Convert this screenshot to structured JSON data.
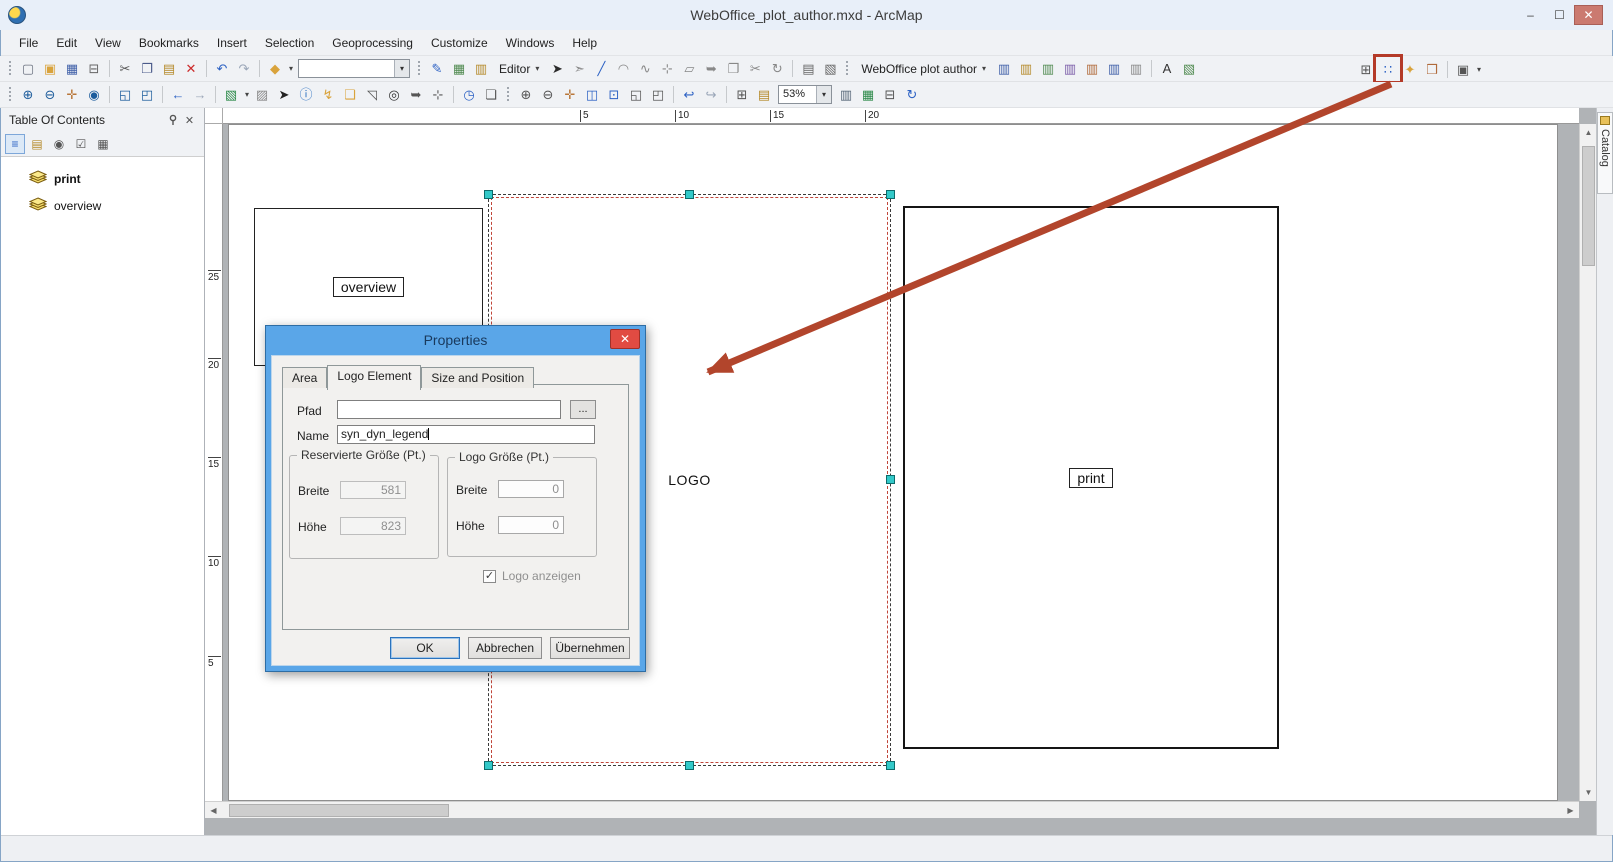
{
  "window": {
    "title": "WebOffice_plot_author.mxd - ArcMap",
    "controls": {
      "minimize": "–",
      "maximize": "☐",
      "close": "✕"
    }
  },
  "menu": [
    "File",
    "Edit",
    "View",
    "Bookmarks",
    "Insert",
    "Selection",
    "Geoprocessing",
    "Customize",
    "Windows",
    "Help"
  ],
  "toolbar1": {
    "items": [
      {
        "type": "grip",
        "name": "toolbar-grip"
      },
      {
        "type": "icon",
        "name": "new-document-icon",
        "glyph": "▢",
        "color": "#6b7280"
      },
      {
        "type": "icon",
        "name": "open-icon",
        "glyph": "▣",
        "color": "#d9a33c"
      },
      {
        "type": "icon",
        "name": "save-icon",
        "glyph": "▦",
        "color": "#3f5fa8"
      },
      {
        "type": "icon",
        "name": "print-icon",
        "glyph": "⊟",
        "color": "#666666"
      },
      {
        "type": "sep"
      },
      {
        "type": "icon",
        "name": "cut-icon",
        "glyph": "✂",
        "color": "#555555"
      },
      {
        "type": "icon",
        "name": "copy-icon",
        "glyph": "❐",
        "color": "#4a5a8a"
      },
      {
        "type": "icon",
        "name": "paste-icon",
        "glyph": "▤",
        "color": "#b58a2a"
      },
      {
        "type": "icon",
        "name": "delete-icon",
        "glyph": "✕",
        "color": "#cc2b2b"
      },
      {
        "type": "sep"
      },
      {
        "type": "icon",
        "name": "undo-icon",
        "glyph": "↶",
        "color": "#2d62c4"
      },
      {
        "type": "icon",
        "name": "redo-icon",
        "glyph": "↷",
        "color": "#9aa6b8"
      },
      {
        "type": "sep"
      },
      {
        "type": "icon",
        "name": "add-data-icon",
        "glyph": "◆",
        "color": "#d9a33c",
        "dropdown": true
      },
      {
        "type": "combo",
        "name": "map-scale-combo",
        "value": "",
        "width": 112
      },
      {
        "type": "grip",
        "name": "toolbar-grip"
      },
      {
        "type": "icon",
        "name": "editor-sketch-icon",
        "glyph": "✎",
        "color": "#2d62c4"
      },
      {
        "type": "icon",
        "name": "snapping-icon",
        "glyph": "▦",
        "color": "#4f8a4f"
      },
      {
        "type": "icon",
        "name": "create-features-icon",
        "glyph": "▥",
        "color": "#b58a2a"
      },
      {
        "type": "menu-button",
        "name": "editor-menu",
        "label": "Editor"
      },
      {
        "type": "icon",
        "name": "edit-tool-icon",
        "glyph": "➤",
        "color": "#2b2b2b"
      },
      {
        "type": "icon",
        "name": "edit-annotation-icon",
        "glyph": "➣",
        "color": "#888888"
      },
      {
        "type": "icon",
        "name": "straight-segment-icon",
        "glyph": "╱",
        "color": "#2d62c4"
      },
      {
        "type": "icon",
        "name": "arc-segment-icon",
        "glyph": "◠",
        "color": "#888888"
      },
      {
        "type": "icon",
        "name": "trace-icon",
        "glyph": "∿",
        "color": "#888888"
      },
      {
        "type": "icon",
        "name": "point-tool-icon",
        "glyph": "⊹",
        "color": "#888888"
      },
      {
        "type": "icon",
        "name": "edit-vertices-icon",
        "glyph": "▱",
        "color": "#888888"
      },
      {
        "type": "icon",
        "name": "reshape-icon",
        "glyph": "➥",
        "color": "#888888"
      },
      {
        "type": "icon",
        "name": "cut-polygons-icon",
        "glyph": "❐",
        "color": "#888888"
      },
      {
        "type": "icon",
        "name": "split-icon",
        "glyph": "✂",
        "color": "#888888"
      },
      {
        "type": "icon",
        "name": "rotate-icon",
        "glyph": "↻",
        "color": "#888888"
      },
      {
        "type": "sep"
      },
      {
        "type": "icon",
        "name": "attributes-icon",
        "glyph": "▤",
        "color": "#666666"
      },
      {
        "type": "icon",
        "name": "sketch-properties-icon",
        "glyph": "▧",
        "color": "#666666"
      },
      {
        "type": "grip",
        "name": "toolbar-grip"
      },
      {
        "type": "menu-button",
        "name": "weboffice-plot-author-menu",
        "label": "WebOffice plot author"
      },
      {
        "type": "icon",
        "name": "wo-load-icon",
        "glyph": "▥",
        "color": "#3f5fa8"
      },
      {
        "type": "icon",
        "name": "wo-save-icon",
        "glyph": "▥",
        "color": "#b58a2a"
      },
      {
        "type": "icon",
        "name": "wo-new-icon",
        "glyph": "▥",
        "color": "#4f8a4f"
      },
      {
        "type": "icon",
        "name": "wo-import-icon",
        "glyph": "▥",
        "color": "#7a5ca8"
      },
      {
        "type": "icon",
        "name": "wo-export-icon",
        "glyph": "▥",
        "color": "#b06a3a"
      },
      {
        "type": "icon",
        "name": "wo-pages-icon",
        "glyph": "▥",
        "color": "#3f5fa8"
      },
      {
        "type": "icon",
        "name": "wo-frame-icon",
        "glyph": "▥",
        "color": "#888888"
      },
      {
        "type": "sep"
      },
      {
        "type": "icon",
        "name": "text-element-icon",
        "glyph": "A",
        "color": "#333333"
      },
      {
        "type": "icon",
        "name": "label-manager-icon",
        "glyph": "▧",
        "color": "#4f8a4f"
      }
    ],
    "end_items": [
      {
        "type": "icon",
        "name": "grid-icon",
        "glyph": "⊞",
        "color": "#555555"
      },
      {
        "type": "icon",
        "name": "synoptic-legend-icon",
        "glyph": "∷",
        "color": "#2d62c4",
        "highlight": true
      },
      {
        "type": "icon",
        "name": "star-icon",
        "glyph": "✦",
        "color": "#d9a33c"
      },
      {
        "type": "icon",
        "name": "export-icon",
        "glyph": "❒",
        "color": "#b06a3a"
      },
      {
        "type": "sep"
      },
      {
        "type": "icon",
        "name": "layers-menu-icon",
        "glyph": "▣",
        "color": "#555555",
        "dropdown": true
      }
    ]
  },
  "toolbar2": {
    "items": [
      {
        "type": "grip",
        "name": "toolbar-grip"
      },
      {
        "type": "icon",
        "name": "zoom-in-icon",
        "glyph": "⊕",
        "color": "#1c5c9c"
      },
      {
        "type": "icon",
        "name": "zoom-out-icon",
        "glyph": "⊖",
        "color": "#1c5c9c"
      },
      {
        "type": "icon",
        "name": "pan-icon",
        "glyph": "✛",
        "color": "#b9773a"
      },
      {
        "type": "icon",
        "name": "full-extent-icon",
        "glyph": "◉",
        "color": "#1c5c9c"
      },
      {
        "type": "sep"
      },
      {
        "type": "icon",
        "name": "fixed-zoom-in-icon",
        "glyph": "◱",
        "color": "#1c5c9c"
      },
      {
        "type": "icon",
        "name": "fixed-zoom-out-icon",
        "glyph": "◰",
        "color": "#1c5c9c"
      },
      {
        "type": "sep"
      },
      {
        "type": "icon",
        "name": "back-extent-icon",
        "glyph": "←",
        "color": "#2d62c4"
      },
      {
        "type": "icon",
        "name": "forward-extent-icon",
        "glyph": "→",
        "color": "#9aa6b8"
      },
      {
        "type": "sep"
      },
      {
        "type": "icon",
        "name": "select-features-icon",
        "glyph": "▧",
        "color": "#2d8a4a",
        "dropdown": true
      },
      {
        "type": "icon",
        "name": "clear-selection-icon",
        "glyph": "▨",
        "color": "#888888"
      },
      {
        "type": "icon",
        "name": "select-elements-icon",
        "glyph": "➤",
        "color": "#222222"
      },
      {
        "type": "icon",
        "name": "identify-icon",
        "glyph": "ⓘ",
        "color": "#2a6fc0"
      },
      {
        "type": "icon",
        "name": "hyperlink-icon",
        "glyph": "↯",
        "color": "#d9a33c"
      },
      {
        "type": "icon",
        "name": "html-popup-icon",
        "glyph": "❑",
        "color": "#d9a33c"
      },
      {
        "type": "icon",
        "name": "measure-icon",
        "glyph": "◹",
        "color": "#555555"
      },
      {
        "type": "icon",
        "name": "find-icon",
        "glyph": "◎",
        "color": "#333333"
      },
      {
        "type": "icon",
        "name": "find-route-icon",
        "glyph": "➥",
        "color": "#555555"
      },
      {
        "type": "icon",
        "name": "goto-xy-icon",
        "glyph": "⊹",
        "color": "#555555"
      },
      {
        "type": "sep"
      },
      {
        "type": "icon",
        "name": "time-slider-icon",
        "glyph": "◷",
        "color": "#2d62c4"
      },
      {
        "type": "icon",
        "name": "viewer-window-icon",
        "glyph": "❏",
        "color": "#555555"
      },
      {
        "type": "grip",
        "name": "toolbar-grip"
      },
      {
        "type": "icon",
        "name": "layout-zoom-in-icon",
        "glyph": "⊕",
        "color": "#555555"
      },
      {
        "type": "icon",
        "name": "layout-zoom-out-icon",
        "glyph": "⊖",
        "color": "#555555"
      },
      {
        "type": "icon",
        "name": "layout-pan-icon",
        "glyph": "✛",
        "color": "#b9773a"
      },
      {
        "type": "icon",
        "name": "zoom-whole-page-icon",
        "glyph": "◫",
        "color": "#2d62c4"
      },
      {
        "type": "icon",
        "name": "zoom-100-icon",
        "glyph": "⊡",
        "color": "#2d62c4"
      },
      {
        "type": "icon",
        "name": "layout-fixed-zoom-in-icon",
        "glyph": "◱",
        "color": "#555555"
      },
      {
        "type": "icon",
        "name": "layout-fixed-zoom-out-icon",
        "glyph": "◰",
        "color": "#555555"
      },
      {
        "type": "sep"
      },
      {
        "type": "icon",
        "name": "previous-extent-icon",
        "glyph": "↩",
        "color": "#2d62c4"
      },
      {
        "type": "icon",
        "name": "next-extent-icon",
        "glyph": "↪",
        "color": "#9aa6b8"
      },
      {
        "type": "sep"
      },
      {
        "type": "icon",
        "name": "focus-data-frame-icon",
        "glyph": "⊞",
        "color": "#555555"
      },
      {
        "type": "icon",
        "name": "change-layout-icon",
        "glyph": "▤",
        "color": "#b58a2a"
      },
      {
        "type": "combo",
        "name": "zoom-percent-combo",
        "value": "53%",
        "width": 54
      },
      {
        "type": "icon",
        "name": "draft-mode-icon",
        "glyph": "▥",
        "color": "#556677"
      },
      {
        "type": "icon",
        "name": "data-driven-pages-icon",
        "glyph": "▦",
        "color": "#2d8a4a"
      },
      {
        "type": "icon",
        "name": "page-text-icon",
        "glyph": "⊟",
        "color": "#555555"
      },
      {
        "type": "icon",
        "name": "refresh-icon",
        "glyph": "↻",
        "color": "#2d62c4"
      }
    ]
  },
  "toc": {
    "title": "Table Of Contents",
    "close_glyph": "✕",
    "tools": [
      {
        "name": "list-by-drawing-order-icon",
        "glyph": "≡",
        "color": "#2d62c4",
        "pressed": true
      },
      {
        "name": "list-by-source-icon",
        "glyph": "▤",
        "color": "#b58a2a",
        "pressed": false
      },
      {
        "name": "list-by-visibility-icon",
        "glyph": "◉",
        "color": "#555555",
        "pressed": false
      },
      {
        "name": "list-by-selection-icon",
        "glyph": "☑",
        "color": "#555555",
        "pressed": false
      },
      {
        "name": "options-icon",
        "glyph": "▦",
        "color": "#555555",
        "pressed": false
      }
    ],
    "items": [
      {
        "label": "print",
        "bold": true
      },
      {
        "label": "overview",
        "bold": false
      }
    ]
  },
  "rulers": {
    "top_labels": [
      "5",
      "10",
      "15",
      "20"
    ],
    "left_labels": [
      "25",
      "20",
      "15",
      "10",
      "5"
    ]
  },
  "layout": {
    "overview_label": "overview",
    "logo_label": "LOGO",
    "print_label": "print"
  },
  "catalog": {
    "label": "Catalog"
  },
  "dialog": {
    "title": "Properties",
    "close_glyph": "✕",
    "tabs": [
      {
        "label": "Area",
        "active": false
      },
      {
        "label": "Logo Element",
        "active": true
      },
      {
        "label": "Size and Position",
        "active": false
      }
    ],
    "pfad_label": "Pfad",
    "pfad_value": "",
    "browse_label": "...",
    "name_label": "Name",
    "name_value": "syn_dyn_legend",
    "reserved_group": {
      "title": "Reservierte Größe (Pt.)",
      "breite_label": "Breite",
      "breite_value": "581",
      "hoehe_label": "Höhe",
      "hoehe_value": "823"
    },
    "logo_group": {
      "title": "Logo Größe (Pt.)",
      "breite_label": "Breite",
      "breite_value": "0",
      "hoehe_label": "Höhe",
      "hoehe_value": "0"
    },
    "logo_anzeigen": {
      "checked": true,
      "check_glyph": "✓",
      "label": "Logo anzeigen"
    },
    "buttons": {
      "ok": "OK",
      "cancel": "Abbrechen",
      "apply": "Übernehmen"
    }
  },
  "annotation": {
    "color": "#b2452c"
  },
  "status": {
    "text": ""
  }
}
